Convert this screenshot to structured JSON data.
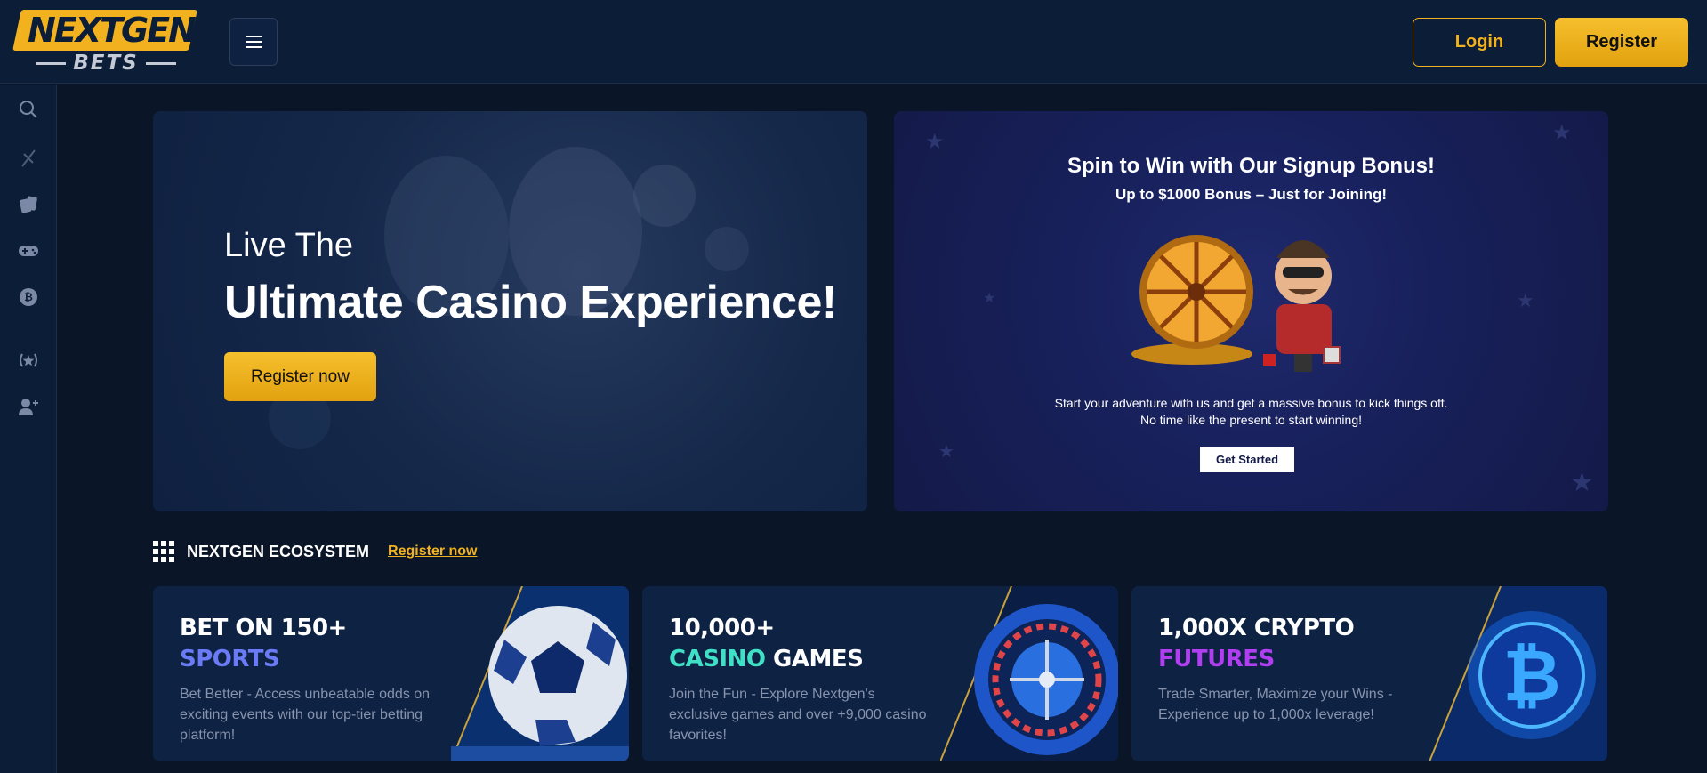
{
  "header": {
    "logo_top": "NEXTGEN",
    "logo_bottom": "BETS",
    "login_label": "Login",
    "register_label": "Register"
  },
  "sidebar": {
    "items": [
      {
        "icon": "search-icon"
      },
      {
        "icon": "sports-icon"
      },
      {
        "icon": "cards-icon"
      },
      {
        "icon": "gamepad-icon"
      },
      {
        "icon": "crypto-icon"
      },
      {
        "icon": "promotions-icon"
      },
      {
        "icon": "add-user-icon"
      }
    ]
  },
  "hero": {
    "line1": "Live The",
    "line2": "Ultimate Casino Experience!",
    "cta": "Register now"
  },
  "promo": {
    "title": "Spin to Win with Our Signup Bonus!",
    "subtitle": "Up to $1000 Bonus – Just for Joining!",
    "desc_line1": "Start your adventure with us and get a massive bonus to kick things off.",
    "desc_line2": "No time like the present to start winning!",
    "cta": "Get Started"
  },
  "ecosystem": {
    "title": "NEXTGEN ECOSYSTEM",
    "link": "Register now"
  },
  "cards": [
    {
      "title1": "BET ON 150+",
      "title2": "SPORTS",
      "title2_color": "#6b7bf5",
      "desc": "Bet Better - Access unbeatable odds on exciting events with our top-tier betting platform!"
    },
    {
      "title1": "10,000+",
      "title2_accent": "CASINO",
      "title2_rest": " GAMES",
      "title2_color": "#3fe0c5",
      "desc": "Join the Fun - Explore Nextgen's exclusive games and over +9,000 casino favorites!"
    },
    {
      "title1": "1,000X CRYPTO",
      "title2": "FUTURES",
      "title2_color": "#b13ef0",
      "desc": "Trade Smarter, Maximize your Wins - Experience up to 1,000x leverage!"
    }
  ],
  "colors": {
    "accent": "#f2b21f",
    "background": "#0a1628",
    "panel": "#0c1d38"
  }
}
